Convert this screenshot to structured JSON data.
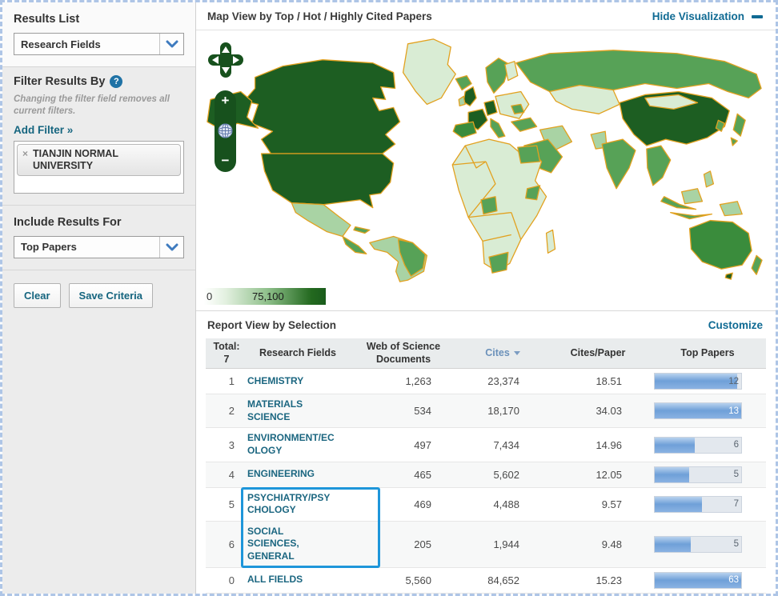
{
  "colors": {
    "link_teal": "#0f6a93",
    "field_link_teal": "#1b6680",
    "highlight_box_blue": "#1e96da",
    "bar_fill_blue": "#79a7db",
    "map_dark_green": "#1d5e22",
    "map_mid_green": "#57a257",
    "map_light_green": "#a9d3a4",
    "map_pale_green": "#d9ecd4",
    "map_border_orange": "#e2a11f",
    "page_border_blue": "#aec5e6"
  },
  "sidebar": {
    "results_list": {
      "title": "Results List",
      "dropdown_value": "Research Fields"
    },
    "filter": {
      "title": "Filter Results By",
      "help_symbol": "?",
      "note": "Changing the filter field removes all current filters.",
      "add_filter": "Add Filter »",
      "tag": {
        "remove_symbol": "×",
        "label": "TIANJIN NORMAL UNIVERSITY"
      }
    },
    "include": {
      "title": "Include Results For",
      "dropdown_value": "Top Papers"
    },
    "buttons": {
      "clear": "Clear",
      "save": "Save Criteria"
    }
  },
  "map_panel": {
    "title": "Map View by Top / Hot / Highly Cited Papers",
    "hide_link": "Hide Visualization",
    "controls": {
      "zoom_in": "+",
      "zoom_out": "−"
    },
    "legend": {
      "min": "0",
      "max": "75,100"
    }
  },
  "report": {
    "title": "Report View by Selection",
    "customize_link": "Customize",
    "table": {
      "headers": {
        "total_label": "Total:",
        "total_value": "7",
        "field": "Research Fields",
        "documents": "Web of Science Documents",
        "cites": "Cites",
        "cites_per_paper": "Cites/Paper",
        "top_papers": "Top Papers"
      },
      "sorted_by": "Cites",
      "rows": [
        {
          "rank": "1",
          "field": "CHEMISTRY",
          "documents": "1,263",
          "cites": "23,374",
          "cites_per_paper": "18.51",
          "top_papers": "12",
          "bar_pct": 95,
          "bar_label_light": false
        },
        {
          "rank": "2",
          "field": "MATERIALS SCIENCE",
          "documents": "534",
          "cites": "18,170",
          "cites_per_paper": "34.03",
          "top_papers": "13",
          "bar_pct": 100,
          "bar_label_light": true
        },
        {
          "rank": "3",
          "field": "ENVIRONMENT/ECOLOGY",
          "documents": "497",
          "cites": "7,434",
          "cites_per_paper": "14.96",
          "top_papers": "6",
          "bar_pct": 46,
          "bar_label_light": false
        },
        {
          "rank": "4",
          "field": "ENGINEERING",
          "documents": "465",
          "cites": "5,602",
          "cites_per_paper": "12.05",
          "top_papers": "5",
          "bar_pct": 40,
          "bar_label_light": false
        },
        {
          "rank": "5",
          "field": "PSYCHIATRY/PSYCHOLOGY",
          "documents": "469",
          "cites": "4,488",
          "cites_per_paper": "9.57",
          "top_papers": "7",
          "bar_pct": 55,
          "bar_label_light": false
        },
        {
          "rank": "6",
          "field": "SOCIAL SCIENCES, GENERAL",
          "documents": "205",
          "cites": "1,944",
          "cites_per_paper": "9.48",
          "top_papers": "5",
          "bar_pct": 42,
          "bar_label_light": false
        },
        {
          "rank": "0",
          "field": "ALL FIELDS",
          "documents": "5,560",
          "cites": "84,652",
          "cites_per_paper": "15.23",
          "top_papers": "63",
          "bar_pct": 100,
          "bar_label_light": true
        }
      ]
    }
  }
}
